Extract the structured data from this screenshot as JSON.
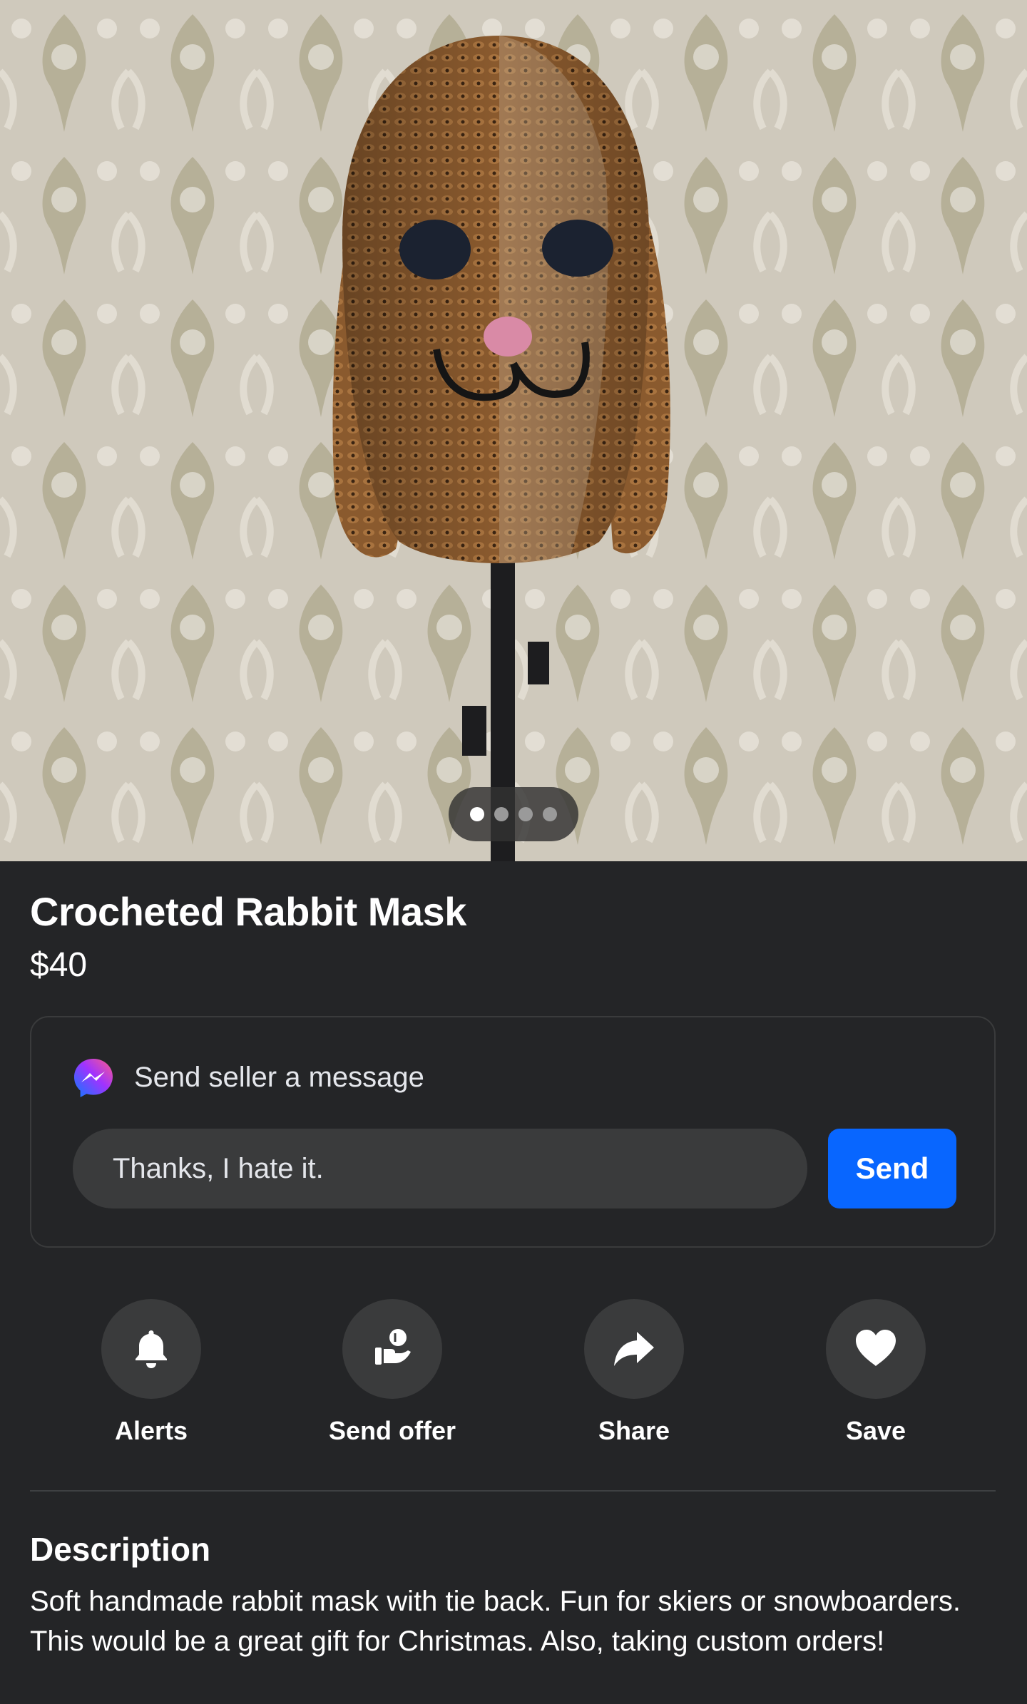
{
  "listing": {
    "title": "Crocheted Rabbit Mask",
    "price": "$40",
    "photo_count": 4,
    "active_photo": 1
  },
  "message": {
    "heading": "Send seller a message",
    "input_value": "Thanks, I hate it.",
    "send_label": "Send",
    "icon": "messenger-icon"
  },
  "actions": [
    {
      "label": "Alerts",
      "icon": "bell-icon"
    },
    {
      "label": "Send offer",
      "icon": "offer-icon"
    },
    {
      "label": "Share",
      "icon": "share-icon"
    },
    {
      "label": "Save",
      "icon": "heart-icon"
    }
  ],
  "description": {
    "heading": "Description",
    "body": "Soft handmade rabbit mask with tie back. Fun for skiers or snowboarders. This would be a great gift for Christmas. Also, taking custom orders!"
  },
  "colors": {
    "background": "#242527",
    "accent": "#0866ff",
    "surface": "#3a3b3c"
  }
}
